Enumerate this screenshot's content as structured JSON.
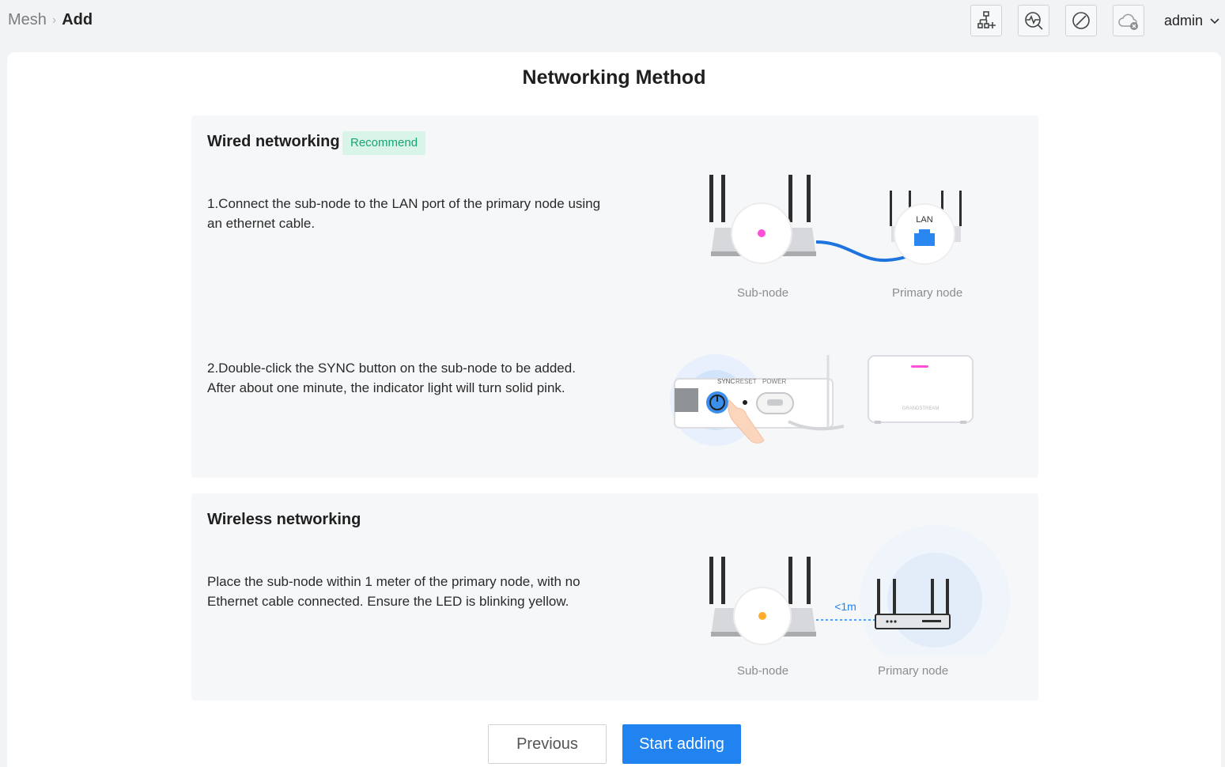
{
  "breadcrumb": {
    "parent": "Mesh",
    "separator": "›",
    "current": "Add"
  },
  "header": {
    "icons": [
      "network-add-icon",
      "diagnose-icon",
      "disable-icon",
      "cloud-offline-icon"
    ],
    "user": "admin"
  },
  "title": "Networking Method",
  "wired": {
    "title": "Wired networking",
    "badge": "Recommend",
    "step1": "1.Connect the sub-node to the LAN port of the primary node using an ethernet cable.",
    "step2_line1": "2.Double-click the SYNC button on the sub-node to be added.",
    "step2_line2": "After about one minute, the indicator light will turn solid pink.",
    "subnode_label": "Sub-node",
    "primary_label": "Primary node",
    "lan_label": "LAN",
    "sync_label": "SYNC",
    "reset_label": "RESET",
    "power_label": "POWER",
    "device_brand": "GRANDSTREAM"
  },
  "wireless": {
    "title": "Wireless networking",
    "description": "Place the sub-node within 1 meter of the primary node, with no Ethernet cable connected. Ensure the LED is blinking yellow.",
    "distance_label": "<1m",
    "subnode_label": "Sub-node",
    "primary_label": "Primary node"
  },
  "buttons": {
    "previous": "Previous",
    "start": "Start adding"
  },
  "colors": {
    "accent": "#2183f0",
    "recommend_bg": "#d9f5ea",
    "recommend_text": "#16a570",
    "led_pink": "#ff4fd8",
    "led_yellow": "#ffab2e"
  }
}
